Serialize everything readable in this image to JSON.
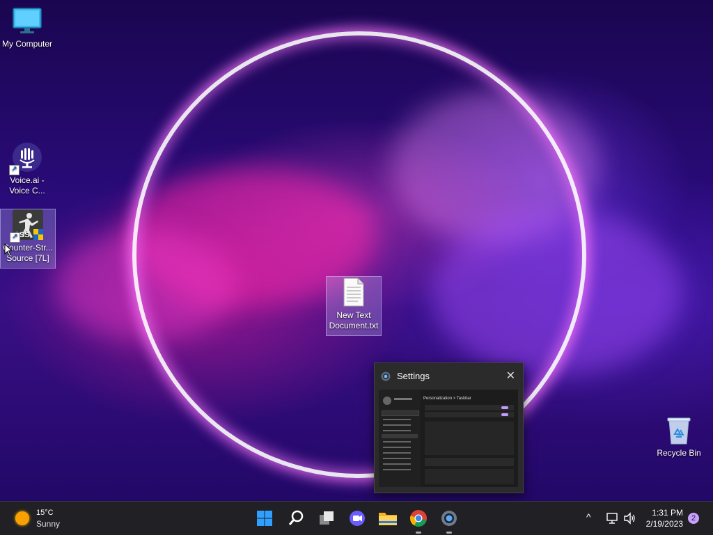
{
  "desktop": {
    "icons": [
      {
        "label": "My Computer"
      },
      {
        "label": "Voice.ai -\nVoice C..."
      },
      {
        "label": "Counter-Str...\nSource [7L]",
        "badge": "CSS"
      },
      {
        "label": "New Text\nDocument.txt"
      },
      {
        "label": "Recycle Bin"
      }
    ]
  },
  "thumbnail": {
    "title": "Settings",
    "close_glyph": "✕",
    "preview_heading": "Personalization > Taskbar"
  },
  "taskbar": {
    "weather": {
      "temp": "15°C",
      "condition": "Sunny"
    },
    "apps": [
      "start-icon",
      "search-icon",
      "task-view-icon",
      "chat-icon",
      "file-explorer-icon",
      "chrome-icon",
      "settings-icon"
    ],
    "tray": {
      "chevron": "^",
      "time": "1:31 PM",
      "date": "2/19/2023",
      "notifications": "2"
    }
  },
  "colors": {
    "taskbar_bg": "#202025",
    "accent_blue": "#0a84ff",
    "notification_badge": "#c9a0ff"
  }
}
